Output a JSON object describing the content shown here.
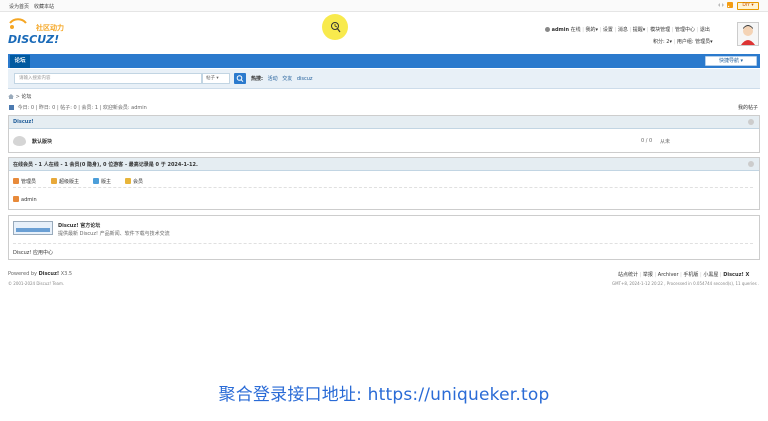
{
  "topbar": {
    "set_home": "设为首页",
    "bookmark": "收藏本站",
    "diy": "DIY ▾"
  },
  "logo": {
    "cn": "社区动力",
    "en": "DISCUZ!"
  },
  "user_bar": {
    "username": "admin",
    "online": "在线",
    "my": "我的",
    "settings": "设置",
    "messages": "消息",
    "reminders": "提醒",
    "modules": "模块管理",
    "admin_center": "管理中心",
    "logout": "退出",
    "points": "积分: 2",
    "user_group": "用户组: 管理员"
  },
  "nav": {
    "forum_tab": "论坛",
    "quick_nav": "快捷导航 ▾"
  },
  "search": {
    "placeholder": "请输入搜索内容",
    "type": "帖子 ▾",
    "hot_label": "热搜:",
    "hot_words": [
      "活动",
      "交友",
      "discuz"
    ]
  },
  "breadcrumb": {
    "separator": ">",
    "current": "论坛"
  },
  "stats": {
    "text": "今日: 0 | 昨日: 0 | 帖子: 0 | 会员: 1 | 欢迎新会员: admin",
    "my_posts": "我的帖子"
  },
  "category": {
    "title": "Discuz!",
    "forum_name": "默认版块",
    "counts": "0 / 0",
    "last_post": "从未"
  },
  "online": {
    "title": "在线会员 - 1 人在线 - 1 会员(0 隐身), 0 位游客 - 最高记录是 0 于 2024-1-12.",
    "roles": [
      {
        "label": "管理员",
        "color": "#e88a3a"
      },
      {
        "label": "超级版主",
        "color": "#e8a93a"
      },
      {
        "label": "版主",
        "color": "#4c9ed9"
      },
      {
        "label": "会员",
        "color": "#e8b53a"
      }
    ],
    "member": "admin"
  },
  "links": {
    "site_name": "Discuz! 官方论坛",
    "site_desc": "提供最新 Discuz! 产品新闻、软件下载与技术交流",
    "app_center": "Discuz! 应用中心"
  },
  "footer": {
    "powered": "Powered by",
    "product": "Discuz!",
    "version": "X3.5",
    "copyright": "© 2001-2024 Discuz! Team.",
    "links": [
      "站点统计",
      "举报",
      "Archiver",
      "手机版",
      "小黑屋"
    ],
    "brand": "Discuz! X",
    "timing": "GMT+8, 2024-1-12 20:22 , Processed in 0.054744 second(s), 11 queries ."
  },
  "caption": "聚合登录接口地址: https://uniqueker.top"
}
